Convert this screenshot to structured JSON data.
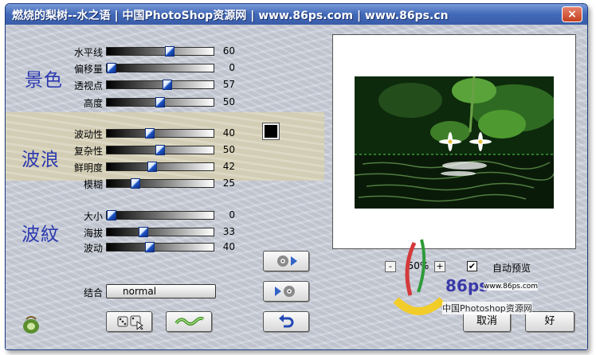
{
  "window": {
    "title": "燃烧的梨树--水之语 | 中国PhotoShop资源网 | www.86ps.com | www.86ps.cn",
    "close_label": "×"
  },
  "sections": {
    "scenery": "景色",
    "waves": "波浪",
    "ripples": "波紋"
  },
  "sliders": {
    "horizon": {
      "label": "水平线",
      "value": "60"
    },
    "offset": {
      "label": "偏移量",
      "value": "0"
    },
    "perspective": {
      "label": "透视点",
      "value": "57"
    },
    "height": {
      "label": "高度",
      "value": "50"
    },
    "fluctuation": {
      "label": "波动性",
      "value": "40"
    },
    "complexity": {
      "label": "复杂性",
      "value": "50"
    },
    "brightness": {
      "label": "鲜明度",
      "value": "42"
    },
    "blur": {
      "label": "模糊",
      "value": "25"
    },
    "size": {
      "label": "大小",
      "value": "0"
    },
    "elevation": {
      "label": "海拔",
      "value": "33"
    },
    "ripple": {
      "label": "波动",
      "value": "40"
    }
  },
  "blend": {
    "label": "结合",
    "value": "normal"
  },
  "zoom": {
    "minus": "-",
    "value": "50%",
    "plus": "+"
  },
  "auto_preview": {
    "label": "自动预览",
    "checked": "✔"
  },
  "buttons": {
    "cancel": "取消",
    "ok": "好"
  },
  "watermark": {
    "text1": "86ps",
    "text2": "www.86ps.com",
    "text3": "中国Photoshop资源网"
  },
  "icons": [
    "dice-icon",
    "wave-icon",
    "play-forward-icon",
    "play-back-icon",
    "undo-icon",
    "plugin-logo-icon",
    "close-icon"
  ]
}
